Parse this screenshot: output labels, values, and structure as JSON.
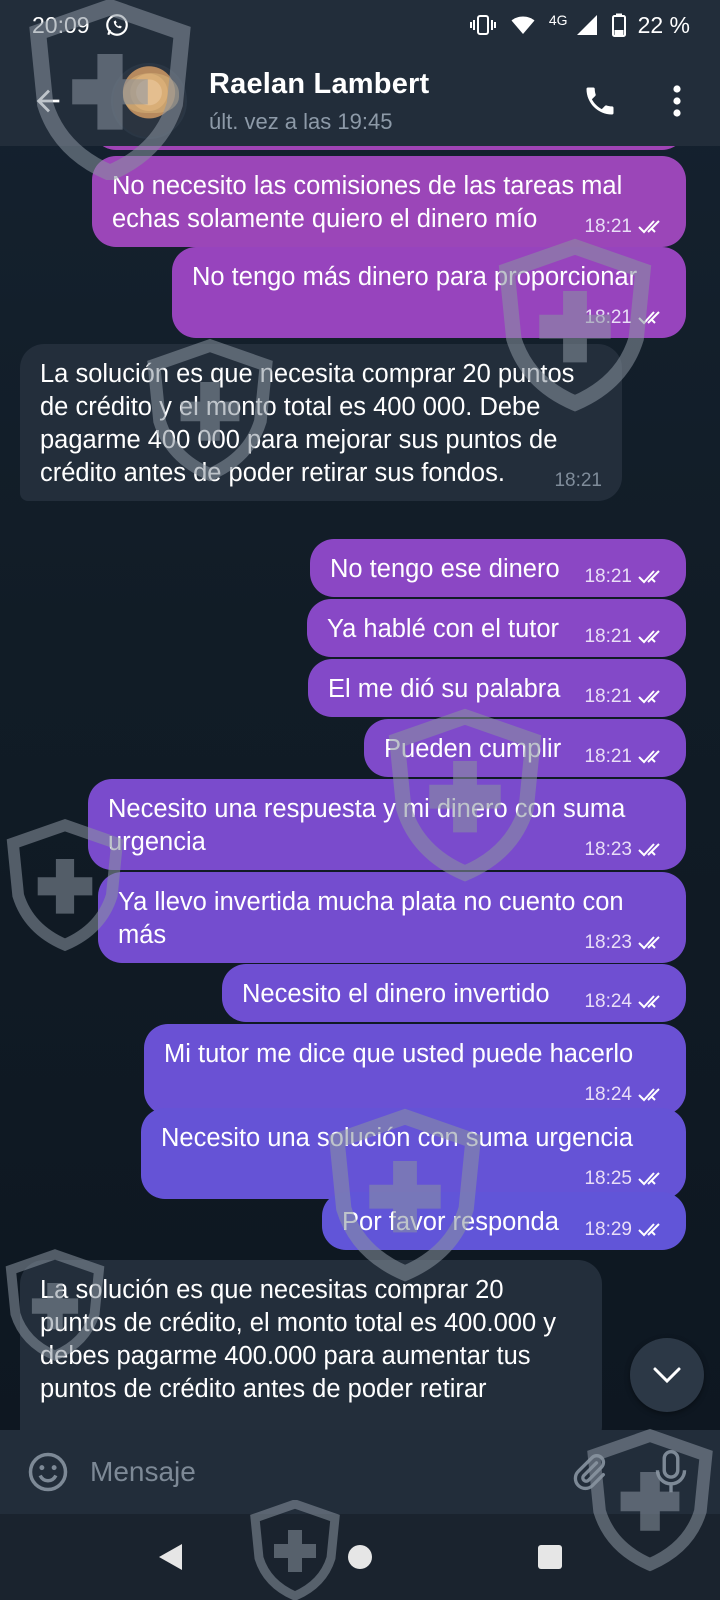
{
  "status_bar": {
    "time": "20:09",
    "network": "4G",
    "battery": "22 %"
  },
  "header": {
    "contact_name": "Raelan Lambert",
    "contact_status": "últ. vez a las 19:45"
  },
  "messages": [
    {
      "dir": "out",
      "text": "No necesito las comisiones de las tareas mal echas solamente quiero el dinero mío",
      "time": "18:21",
      "read": true,
      "color": "#9b46b8"
    },
    {
      "dir": "out",
      "text": "No tengo más dinero para proporcionar",
      "time": "18:21",
      "read": true,
      "color": "#9744bd"
    },
    {
      "dir": "in",
      "text": "La solución es que necesita comprar 20 puntos de crédito y el monto total es 400 000. Debe pagarme 400 000 para mejorar sus puntos de crédito antes de poder retirar sus fondos.",
      "time": "18:21"
    },
    {
      "dir": "out",
      "text": "No tengo ese dinero",
      "time": "18:21",
      "read": true,
      "color": "#8b47c4"
    },
    {
      "dir": "out",
      "text": "Ya hablé con el tutor",
      "time": "18:21",
      "read": true,
      "color": "#8848c6"
    },
    {
      "dir": "out",
      "text": "El me dió su palabra",
      "time": "18:21",
      "read": true,
      "color": "#8349c8"
    },
    {
      "dir": "out",
      "text": "Pueden cumplir",
      "time": "18:21",
      "read": true,
      "color": "#7f4aca"
    },
    {
      "dir": "out",
      "text": "Necesito una respuesta y mi dinero con suma urgencia",
      "time": "18:23",
      "read": true,
      "color": "#7a4bcc"
    },
    {
      "dir": "out",
      "text": "Ya llevo invertida mucha plata no cuento con más",
      "time": "18:23",
      "read": true,
      "color": "#744dcf"
    },
    {
      "dir": "out",
      "text": "Necesito el dinero invertido",
      "time": "18:24",
      "read": true,
      "color": "#6f4fd2"
    },
    {
      "dir": "out",
      "text": "Mi tutor me dice que usted puede hacerlo",
      "time": "18:24",
      "read": true,
      "color": "#6a51d4"
    },
    {
      "dir": "out",
      "text": "Necesito una solución con suma urgencia",
      "time": "18:25",
      "read": true,
      "color": "#6553d6"
    },
    {
      "dir": "out",
      "text": "Por favor responda",
      "time": "18:29",
      "read": true,
      "color": "#6155d8"
    },
    {
      "dir": "in",
      "text": "La solución es que necesitas comprar 20 puntos de crédito, el monto total es 400.000 y debes pagarme 400.000 para aumentar tus puntos de crédito antes de poder retirar",
      "time": ""
    }
  ],
  "input": {
    "placeholder": "Mensaje"
  },
  "icons": {
    "back": "back-arrow-icon",
    "call": "phone-icon",
    "more": "more-vertical-icon",
    "emoji": "emoji-icon",
    "attach": "paperclip-icon",
    "mic": "microphone-icon",
    "scroll_down": "chevron-down-icon"
  }
}
